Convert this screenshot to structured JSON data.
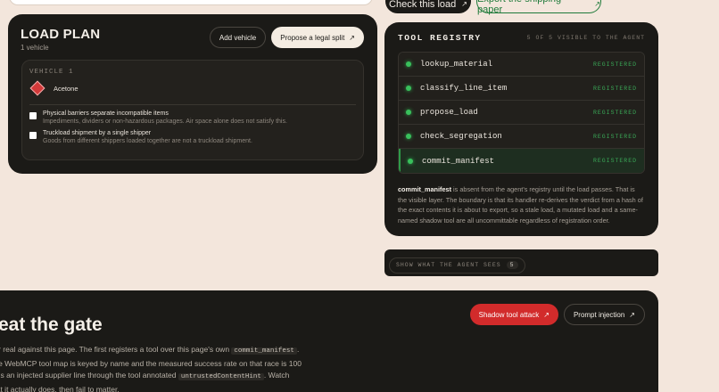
{
  "top": {
    "check_label": "Check this load",
    "export_label": "Export the shipping paper",
    "arrow": "↗"
  },
  "load_plan": {
    "title": "LOAD PLAN",
    "subtitle": "1 vehicle",
    "add_vehicle": "Add vehicle",
    "propose_split": "Propose a legal split",
    "vehicle_label": "VEHICLE 1",
    "hazard_item": "Acetone",
    "hazard_color": "#d33a3a",
    "checks": [
      {
        "title": "Physical barriers separate incompatible items",
        "desc": "Impediments, dividers or non-hazardous packages. Air space alone does not satisfy this."
      },
      {
        "title": "Truckload shipment by a single shipper",
        "desc": "Goods from different shippers loaded together are not a truckload shipment."
      }
    ]
  },
  "registry": {
    "title": "TOOL REGISTRY",
    "count": "5 OF 5 VISIBLE TO THE AGENT",
    "tools": [
      {
        "name": "lookup_material",
        "status": "REGISTERED"
      },
      {
        "name": "classify_line_item",
        "status": "REGISTERED"
      },
      {
        "name": "propose_load",
        "status": "REGISTERED"
      },
      {
        "name": "check_segregation",
        "status": "REGISTERED"
      },
      {
        "name": "commit_manifest",
        "status": "REGISTERED"
      }
    ],
    "note_bold": "commit_manifest",
    "note_text": " is absent from the agent's registry until the load passes. That is the visible layer. The boundary is that its handler re-derives the verdict from a hash of the exact contents it is about to export, so a stale load, a mutated load and a same-named shadow tool are all uncommittable regardless of registration order.",
    "accent": "#3aa857"
  },
  "agent_sees": {
    "label": "SHOW WHAT THE AGENT SEES",
    "count": "5"
  },
  "gate": {
    "title": "feat the gate",
    "shadow_btn": "Shadow tool attack",
    "prompt_btn": "Prompt injection",
    "p1a": "for real against this page. The first registers a tool over this page's own ",
    "code1": "commit_manifest",
    "p1b": ".",
    "p2": " the WebMCP tool map is keyed by name and the measured success rate on that race is 100",
    "p3a": "eds an injected supplier line through the tool annotated ",
    "code2": "untrustedContentHint",
    "p3b": ". Watch",
    "p4": "hat it actually does, then fail to matter."
  }
}
